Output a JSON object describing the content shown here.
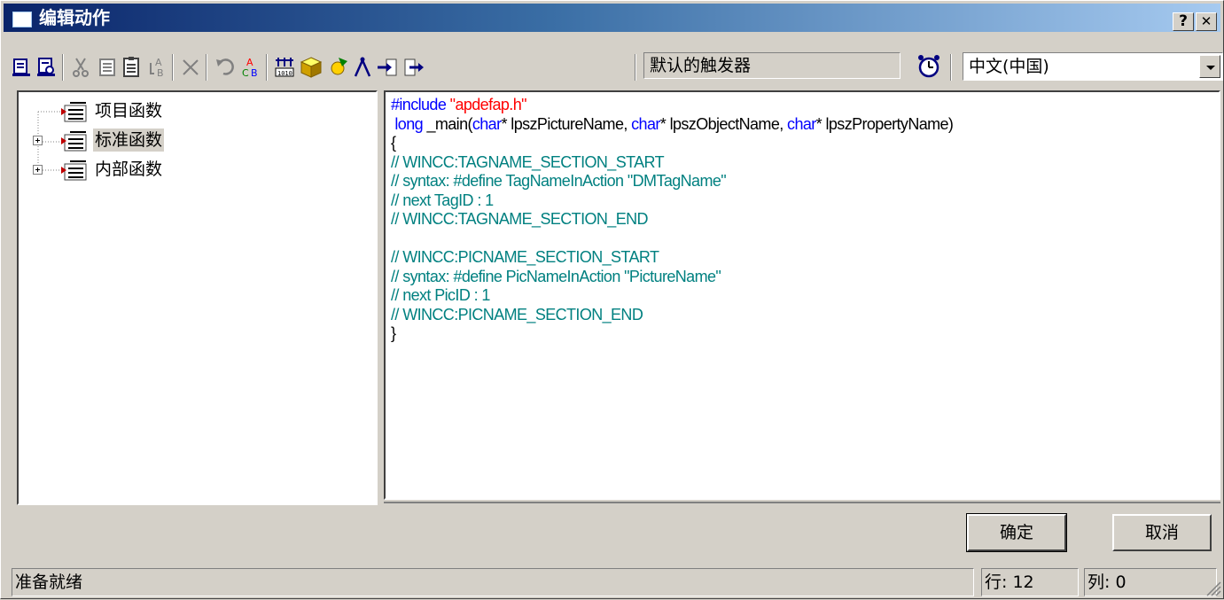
{
  "window": {
    "title": "编辑动作",
    "help_button": "?",
    "close_button": "✕"
  },
  "toolbar": {
    "trigger": "默认的触发器",
    "language": "中文(中国)"
  },
  "tree": {
    "items": [
      {
        "label": "项目函数",
        "expandable": false,
        "selected": false
      },
      {
        "label": "标准函数",
        "expandable": true,
        "selected": true
      },
      {
        "label": "内部函数",
        "expandable": true,
        "selected": false
      }
    ]
  },
  "editor": {
    "lines": [
      [
        {
          "t": "#include ",
          "c": "kw"
        },
        {
          "t": "\"apdefap.h\"",
          "c": "str"
        }
      ],
      [
        {
          "t": " long",
          "c": "kw"
        },
        {
          "t": " _main(",
          "c": ""
        },
        {
          "t": "char",
          "c": "kw"
        },
        {
          "t": "* lpszPictureName, ",
          "c": ""
        },
        {
          "t": "char",
          "c": "kw"
        },
        {
          "t": "* lpszObjectName, ",
          "c": ""
        },
        {
          "t": "char",
          "c": "kw"
        },
        {
          "t": "* lpszPropertyName)",
          "c": ""
        }
      ],
      [
        {
          "t": "{",
          "c": ""
        }
      ],
      [
        {
          "t": "// WINCC:TAGNAME_SECTION_START",
          "c": "cm"
        }
      ],
      [
        {
          "t": "// syntax: #define TagNameInAction \"DMTagName\"",
          "c": "cm"
        }
      ],
      [
        {
          "t": "// next TagID : 1",
          "c": "cm"
        }
      ],
      [
        {
          "t": "// WINCC:TAGNAME_SECTION_END",
          "c": "cm"
        }
      ],
      [
        {
          "t": "",
          "c": ""
        }
      ],
      [
        {
          "t": "// WINCC:PICNAME_SECTION_START",
          "c": "cm"
        }
      ],
      [
        {
          "t": "// syntax: #define PicNameInAction \"PictureName\"",
          "c": "cm"
        }
      ],
      [
        {
          "t": "// next PicID : 1",
          "c": "cm"
        }
      ],
      [
        {
          "t": "// WINCC:PICNAME_SECTION_END",
          "c": "cm"
        }
      ],
      [
        {
          "t": "}",
          "c": ""
        }
      ]
    ]
  },
  "buttons": {
    "ok": "确定",
    "cancel": "取消"
  },
  "status": {
    "message": "准备就绪",
    "row": "行: 12",
    "col": "列: 0"
  },
  "colors": {
    "keyword": "#0000ff",
    "string": "#ff0000",
    "comment": "#008080"
  }
}
